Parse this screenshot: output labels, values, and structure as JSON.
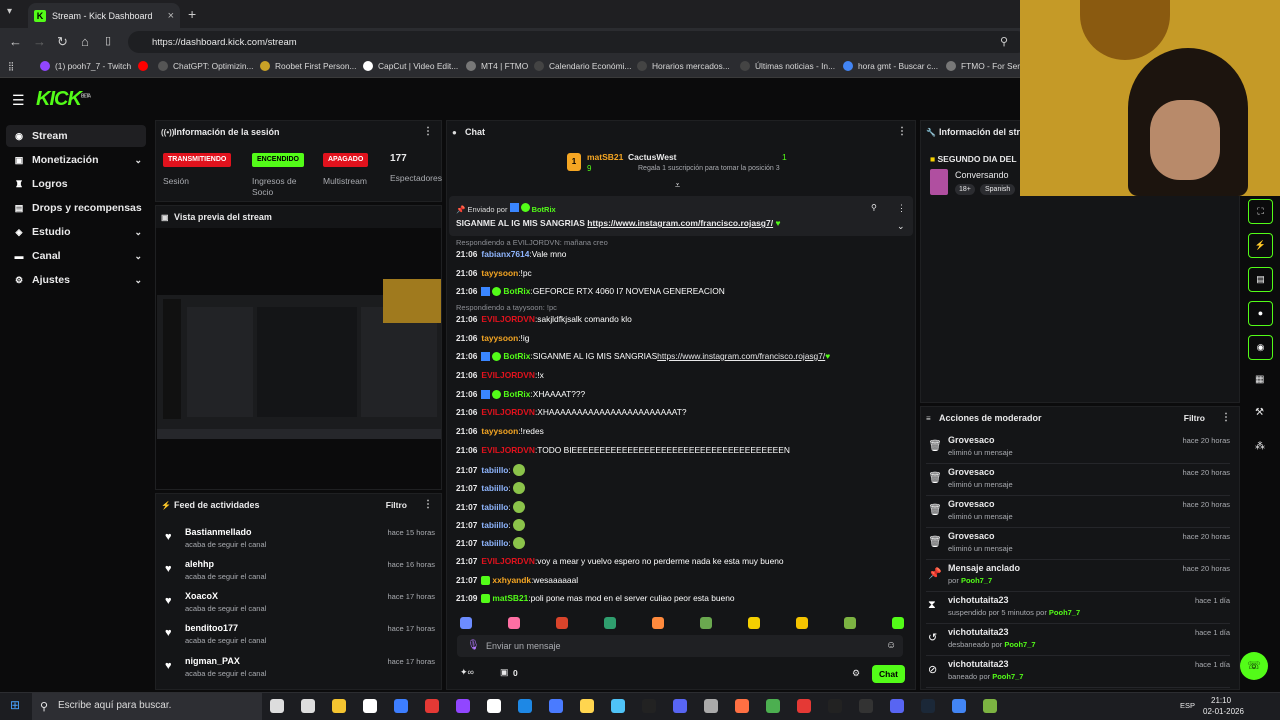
{
  "browser": {
    "tab_title": "Stream - Kick Dashboard",
    "url": "https://dashboard.kick.com/stream",
    "bookmarks": [
      "(1) pooh7_7 - Twitch",
      "ChatGPT: Optimizin...",
      "Roobet First Person...",
      "CapCut | Video Edit...",
      "MT4 | FTMO",
      "Calendario Económi...",
      "Horarios mercados...",
      "Últimas noticias - In...",
      "hora gmt - Buscar c...",
      "FTMO - For Serio"
    ]
  },
  "app": {
    "logo": "KICK",
    "logo_tag": "BETA"
  },
  "sidebar": {
    "items": [
      {
        "label": "Stream",
        "icon": "broadcast-icon"
      },
      {
        "label": "Monetización",
        "icon": "dollar-icon"
      },
      {
        "label": "Logros",
        "icon": "trophy-icon"
      },
      {
        "label": "Drops y recompensas",
        "icon": "gift-icon"
      },
      {
        "label": "Estudio",
        "icon": "studio-icon"
      },
      {
        "label": "Canal",
        "icon": "channel-icon"
      },
      {
        "label": "Ajustes",
        "icon": "gear-icon"
      }
    ]
  },
  "session": {
    "title": "Información de la sesión",
    "badges": [
      {
        "label": "TRANSMITIENDO",
        "caption": "Sesión",
        "color": "#e1121d"
      },
      {
        "label": "ENCENDIDO",
        "caption": "Ingresos de Socio",
        "color": "#53fc18"
      },
      {
        "label": "APAGADO",
        "caption": "Multistream",
        "color": "#e1121d"
      }
    ],
    "viewers": "177",
    "viewers_label": "Espectadores"
  },
  "preview": {
    "title": "Vista previa del stream"
  },
  "activity": {
    "title": "Feed de actividades",
    "filter": "Filtro",
    "items": [
      {
        "name": "Bastianmellado",
        "sub": "acaba de seguir el canal",
        "time": "hace 15 horas"
      },
      {
        "name": "alehhp",
        "sub": "acaba de seguir el canal",
        "time": "hace 16 horas"
      },
      {
        "name": "XoacoX",
        "sub": "acaba de seguir el canal",
        "time": "hace 17 horas"
      },
      {
        "name": "benditoo177",
        "sub": "acaba de seguir el canal",
        "time": "hace 17 horas"
      },
      {
        "name": "nigman_PAX",
        "sub": "acaba de seguir el canal",
        "time": "hace 17 horas"
      }
    ]
  },
  "chat": {
    "title": "Chat",
    "top_gifter": {
      "name": "matSB21",
      "count": "9",
      "channel": "CactusWest",
      "channel_count": "1",
      "hint": "Regala 1 suscripción para tomar la posición 3"
    },
    "pinned": {
      "label": "Enviado por",
      "by": "BotRix",
      "message": "SIGANME AL IG MIS SANGRIAS ",
      "link": "https://www.instagram.com/francisco.rojasg7/"
    },
    "reply_top": "Respondiendo a EVILJORDVN: mañana creo",
    "messages": [
      {
        "time": "21:06",
        "user": "fabianx7614",
        "color": "#8fb6ff",
        "text": "Vale mno"
      },
      {
        "time": "21:06",
        "user": "tayysoon",
        "color": "#f5a623",
        "text": "!pc"
      },
      {
        "time": "21:06",
        "user": "BotRix",
        "color": "#53fc18",
        "text": "GEFORCE RTX 4060 I7 NOVENA GENEREACION"
      },
      {
        "time": "21:06",
        "user": "EVILJORDVN",
        "color": "#e1121d",
        "text": "sakjldfkjsalk comando klo"
      },
      {
        "time": "21:06",
        "user": "tayysoon",
        "color": "#f5a623",
        "text": "!ig"
      },
      {
        "time": "21:06",
        "user": "BotRix",
        "color": "#53fc18",
        "text": "SIGANME AL IG MIS SANGRIAS ",
        "link": "https://www.instagram.com/francisco.rojasg7/"
      },
      {
        "time": "21:06",
        "user": "EVILJORDVN",
        "color": "#e1121d",
        "text": "!x"
      },
      {
        "time": "21:06",
        "user": "BotRix",
        "color": "#53fc18",
        "text": "XHAAAAT???"
      },
      {
        "time": "21:06",
        "user": "EVILJORDVN",
        "color": "#e1121d",
        "text": "XHAAAAAAAAAAAAAAAAAAAAAAAT?"
      },
      {
        "time": "21:06",
        "user": "tayysoon",
        "color": "#f5a623",
        "text": "!redes"
      },
      {
        "time": "21:06",
        "user": "EVILJORDVN",
        "color": "#e1121d",
        "text": "TODO BIEEEEEEEEEEEEEEEEEEEEEEEEEEEEEEEEEEEEEEN"
      },
      {
        "time": "21:07",
        "user": "tabiillo",
        "color": "#8fb6ff",
        "text": ""
      },
      {
        "time": "21:07",
        "user": "tabiillo",
        "color": "#8fb6ff",
        "text": ""
      },
      {
        "time": "21:07",
        "user": "tabiillo",
        "color": "#8fb6ff",
        "text": ""
      },
      {
        "time": "21:07",
        "user": "tabiillo",
        "color": "#8fb6ff",
        "text": ""
      },
      {
        "time": "21:07",
        "user": "tabiillo",
        "color": "#8fb6ff",
        "text": ""
      },
      {
        "time": "21:07",
        "user": "EVILJORDVN",
        "color": "#e1121d",
        "text": "voy a mear y vuelvo espero no perderme nada ke esta muy bueno"
      },
      {
        "time": "21:07",
        "user": "xxhyandk",
        "color": "#f5a623",
        "text": "wesaaaaaal"
      },
      {
        "time": "21:09",
        "user": "matSB21",
        "color": "#53fc18",
        "text": "poli pone mas mod en el server culiao peor esta bueno"
      }
    ],
    "reply_mid": "Respondiendo a tayysoon: !pc",
    "input_placeholder": "Enviar un mensaje",
    "points": "0",
    "send": "Chat"
  },
  "stream_info": {
    "title": "Información del stre",
    "stream_title": "SEGUNDO DIA DEL",
    "category": "Conversando",
    "tags": [
      "18+",
      "Spanish"
    ]
  },
  "mod_actions": {
    "title": "Acciones de moderador",
    "filter": "Filtro",
    "items": [
      {
        "name": "Grovesaco",
        "sub": "eliminó un mensaje",
        "by": "",
        "time": "hace 20 horas",
        "icon": "trash-icon"
      },
      {
        "name": "Grovesaco",
        "sub": "eliminó un mensaje",
        "by": "",
        "time": "hace 20 horas",
        "icon": "trash-icon"
      },
      {
        "name": "Grovesaco",
        "sub": "eliminó un mensaje",
        "by": "",
        "time": "hace 20 horas",
        "icon": "trash-icon"
      },
      {
        "name": "Grovesaco",
        "sub": "eliminó un mensaje",
        "by": "",
        "time": "hace 20 horas",
        "icon": "trash-icon"
      },
      {
        "name": "Mensaje anclado",
        "sub": "por ",
        "by": "Pooh7_7",
        "time": "hace 20 horas",
        "icon": "pin-icon"
      },
      {
        "name": "vichotutaita23",
        "sub": "suspendido por 5 minutos por ",
        "by": "Pooh7_7",
        "time": "hace 1 día",
        "icon": "hourglass-icon"
      },
      {
        "name": "vichotutaita23",
        "sub": "desbaneado por ",
        "by": "Pooh7_7",
        "time": "hace 1 día",
        "icon": "undo-icon"
      },
      {
        "name": "vichotutaita23",
        "sub": "baneado por ",
        "by": "Pooh7_7",
        "time": "hace 1 día",
        "icon": "ban-icon"
      }
    ]
  },
  "taskbar": {
    "search": "Escribe aquí para buscar.",
    "lang": "ESP",
    "time": "21:10",
    "date": "02-01-2026"
  }
}
